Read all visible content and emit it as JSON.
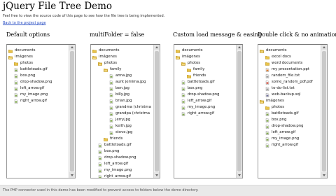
{
  "page": {
    "title": "jQuery File Tree Demo",
    "intro": "Feel free to view the source code of this page to see how the file tree is being implemented.",
    "back_link": "Back to the project page",
    "footer": "The PHP connector used in this demo has been modified to prevent access to folders below the demo directory."
  },
  "panels": [
    {
      "title": "Default options",
      "nodes": [
        {
          "label": "documents",
          "icon": "folder-icon",
          "depth": 0
        },
        {
          "label": "imágenes",
          "icon": "folder-open-icon",
          "depth": 0
        },
        {
          "label": "photos",
          "icon": "folder-icon",
          "depth": 1
        },
        {
          "label": "battletoads.gif",
          "icon": "image-file-icon",
          "depth": 1
        },
        {
          "label": "box.png",
          "icon": "image-file-icon",
          "depth": 1
        },
        {
          "label": "drop-shadow.png",
          "icon": "image-file-icon",
          "depth": 1
        },
        {
          "label": "left_arrow.gif",
          "icon": "image-file-icon",
          "depth": 1
        },
        {
          "label": "my_image.png",
          "icon": "image-file-icon",
          "depth": 1
        },
        {
          "label": "right_arrow.gif",
          "icon": "image-file-icon",
          "depth": 1
        }
      ]
    },
    {
      "title": "multiFolder = false",
      "nodes": [
        {
          "label": "documents",
          "icon": "folder-icon",
          "depth": 0
        },
        {
          "label": "imágenes",
          "icon": "folder-open-icon",
          "depth": 0
        },
        {
          "label": "photos",
          "icon": "folder-open-icon",
          "depth": 1
        },
        {
          "label": "family",
          "icon": "folder-open-icon",
          "depth": 2
        },
        {
          "label": "anna.jpg",
          "icon": "image-file-icon",
          "depth": 3
        },
        {
          "label": "aunt jemima.jpg",
          "icon": "image-file-icon",
          "depth": 3
        },
        {
          "label": "ben.jpg",
          "icon": "image-file-icon",
          "depth": 3
        },
        {
          "label": "billy.jpg",
          "icon": "image-file-icon",
          "depth": 3
        },
        {
          "label": "brian.jpg",
          "icon": "image-file-icon",
          "depth": 3
        },
        {
          "label": "grandma (christma",
          "icon": "image-file-icon",
          "depth": 3
        },
        {
          "label": "grandpa (christma",
          "icon": "image-file-icon",
          "depth": 3
        },
        {
          "label": "jerry.jpg",
          "icon": "image-file-icon",
          "depth": 3
        },
        {
          "label": "keith.jpg",
          "icon": "image-file-icon",
          "depth": 3
        },
        {
          "label": "steve.jpg",
          "icon": "image-file-icon",
          "depth": 3
        },
        {
          "label": "friends",
          "icon": "folder-icon",
          "depth": 2
        },
        {
          "label": "battletoads.gif",
          "icon": "image-file-icon",
          "depth": 1
        },
        {
          "label": "box.png",
          "icon": "image-file-icon",
          "depth": 1
        },
        {
          "label": "drop-shadow.png",
          "icon": "image-file-icon",
          "depth": 1
        },
        {
          "label": "left_arrow.gif",
          "icon": "image-file-icon",
          "depth": 1
        },
        {
          "label": "my_image.png",
          "icon": "image-file-icon",
          "depth": 1
        },
        {
          "label": "right_arrow.gif",
          "icon": "image-file-icon",
          "depth": 1
        }
      ]
    },
    {
      "title": "Custom load message & easing",
      "nodes": [
        {
          "label": "documents",
          "icon": "folder-icon",
          "depth": 0
        },
        {
          "label": "imágenes",
          "icon": "folder-open-icon",
          "depth": 0
        },
        {
          "label": "photos",
          "icon": "folder-open-icon",
          "depth": 1
        },
        {
          "label": "family",
          "icon": "folder-icon",
          "depth": 2
        },
        {
          "label": "friends",
          "icon": "folder-icon",
          "depth": 2
        },
        {
          "label": "battletoads.gif",
          "icon": "image-file-icon",
          "depth": 1
        },
        {
          "label": "box.png",
          "icon": "image-file-icon",
          "depth": 1
        },
        {
          "label": "drop-shadow.png",
          "icon": "image-file-icon",
          "depth": 1
        },
        {
          "label": "left_arrow.gif",
          "icon": "image-file-icon",
          "depth": 1
        },
        {
          "label": "my_image.png",
          "icon": "image-file-icon",
          "depth": 1
        },
        {
          "label": "right_arrow.gif",
          "icon": "image-file-icon",
          "depth": 1
        }
      ]
    },
    {
      "title": "Double click & no animation",
      "nodes": [
        {
          "label": "documents",
          "icon": "folder-open-icon",
          "depth": 0
        },
        {
          "label": "excel docs",
          "icon": "folder-icon",
          "depth": 1
        },
        {
          "label": "word documents",
          "icon": "folder-icon",
          "depth": 1
        },
        {
          "label": "my presentation.ppt",
          "icon": "presentation-file-icon",
          "depth": 1
        },
        {
          "label": "random_file.txt",
          "icon": "text-file-icon",
          "depth": 1
        },
        {
          "label": "some_random_pdf.pdf",
          "icon": "pdf-file-icon",
          "depth": 1
        },
        {
          "label": "to-do-list.txt",
          "icon": "text-file-icon",
          "depth": 1
        },
        {
          "label": "web-backup.sql",
          "icon": "database-file-icon",
          "depth": 1
        },
        {
          "label": "imágenes",
          "icon": "folder-open-icon",
          "depth": 0
        },
        {
          "label": "photos",
          "icon": "folder-icon",
          "depth": 1
        },
        {
          "label": "battletoads.gif",
          "icon": "image-file-icon",
          "depth": 1
        },
        {
          "label": "box.png",
          "icon": "image-file-icon",
          "depth": 1
        },
        {
          "label": "drop-shadow.png",
          "icon": "image-file-icon",
          "depth": 1
        },
        {
          "label": "left_arrow.gif",
          "icon": "image-file-icon",
          "depth": 1
        },
        {
          "label": "my_image.png",
          "icon": "image-file-icon",
          "depth": 1
        },
        {
          "label": "right_arrow.gif",
          "icon": "image-file-icon",
          "depth": 1
        }
      ]
    }
  ],
  "colors": {
    "folder": "#e8c34a",
    "folder_edge": "#b48a1c",
    "image_file": "#7fa84a",
    "text_file": "#9a9a9a",
    "pdf_file": "#d04a3a",
    "presentation_file": "#e07a2a",
    "database_file": "#6f6f9a",
    "link": "#2a4fc4",
    "footer_bg": "#e9e9e9"
  }
}
